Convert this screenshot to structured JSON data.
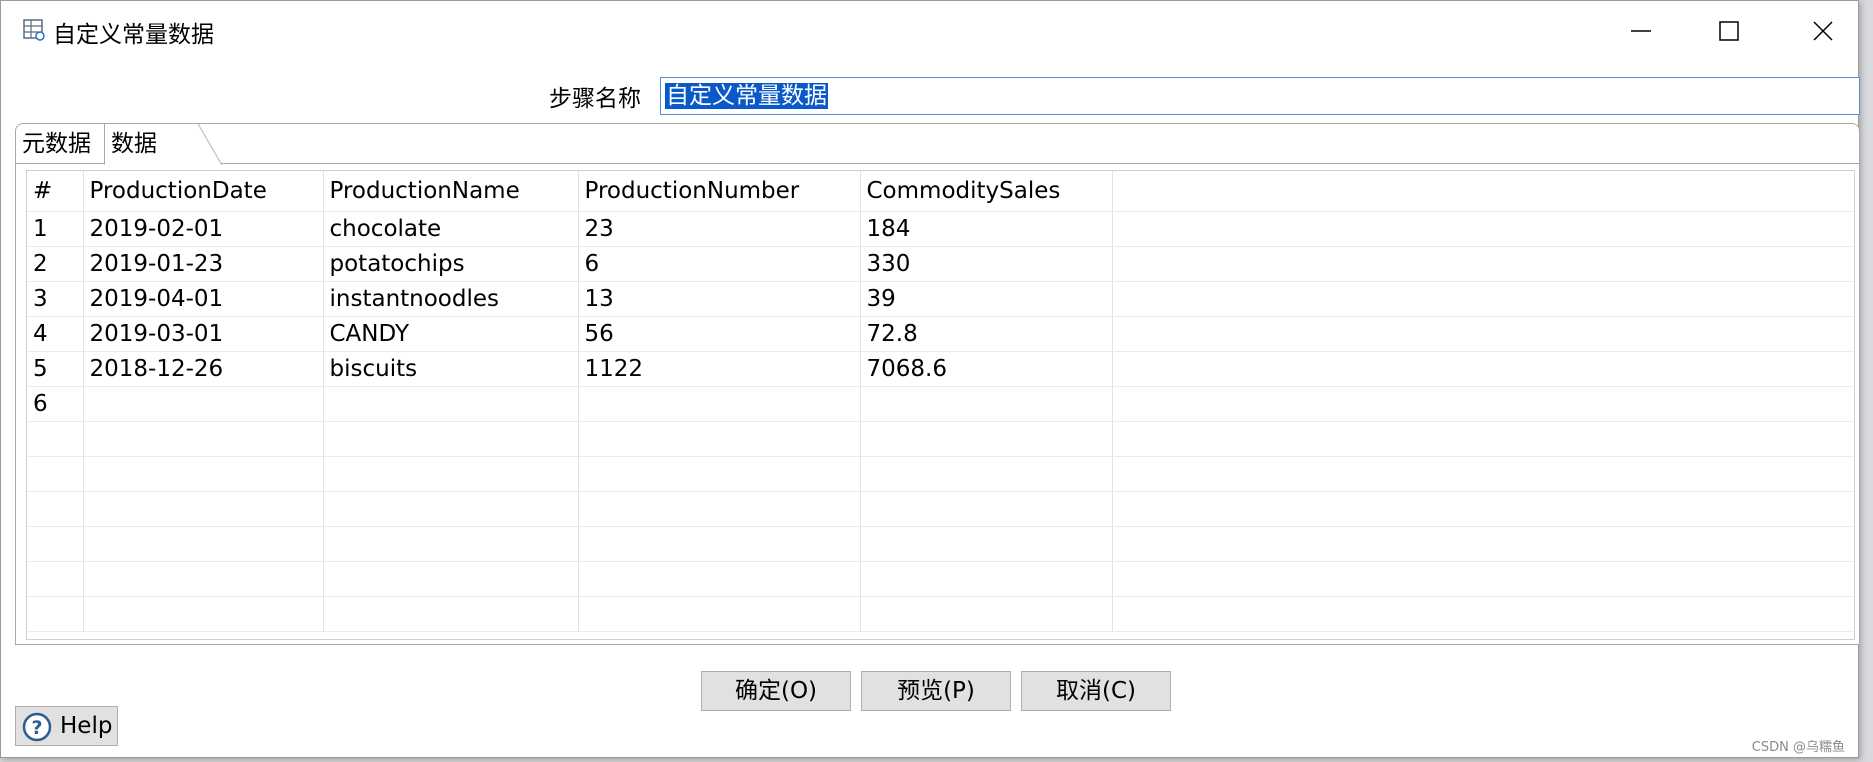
{
  "window": {
    "title": "自定义常量数据",
    "icon": "table-grid-icon",
    "controls": [
      "minimize-icon",
      "maximize-icon",
      "close-icon"
    ]
  },
  "step_name": {
    "label": "步骤名称",
    "value": "自定义常量数据"
  },
  "tabs": [
    {
      "label": "元数据",
      "active": false
    },
    {
      "label": "数据",
      "active": true
    }
  ],
  "grid": {
    "columns": [
      "#",
      "ProductionDate",
      "ProductionName",
      "ProductionNumber",
      "CommoditySales"
    ],
    "rows": [
      [
        "1",
        "2019-02-01",
        "chocolate",
        "23",
        "184"
      ],
      [
        "2",
        "2019-01-23",
        "potatochips",
        "6",
        "330"
      ],
      [
        "3",
        "2019-04-01",
        "instantnoodles",
        "13",
        "39"
      ],
      [
        "4",
        "2019-03-01",
        "CANDY",
        "56",
        "72.8"
      ],
      [
        "5",
        "2018-12-26",
        "biscuits",
        "1122",
        "7068.6"
      ],
      [
        "6",
        "",
        "",
        "",
        ""
      ]
    ]
  },
  "buttons": {
    "ok": "确定(O)",
    "preview": "预览(P)",
    "cancel": "取消(C)",
    "help": "Help"
  },
  "watermark": "CSDN @乌糯鱼",
  "colors": {
    "selection": "#0a59c8",
    "focus_border": "#4f90d6",
    "button_bg": "#e1e1e1"
  }
}
